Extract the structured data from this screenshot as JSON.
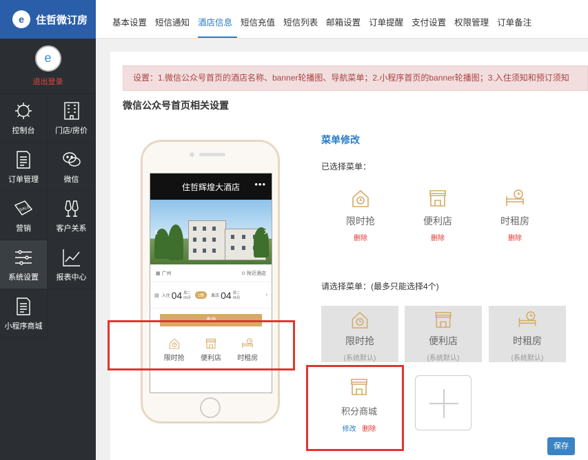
{
  "brand": {
    "name": "住哲微订房"
  },
  "user": {
    "logout": "退出登录"
  },
  "sidebar": {
    "items": [
      {
        "label": "控制台",
        "icon": "dashboard-icon"
      },
      {
        "label": "门店/房价",
        "icon": "building-icon"
      },
      {
        "label": "订单管理",
        "icon": "document-icon"
      },
      {
        "label": "微信",
        "icon": "wechat-icon"
      },
      {
        "label": "营销",
        "icon": "sale-tag-icon"
      },
      {
        "label": "客户关系",
        "icon": "glasses-icon"
      },
      {
        "label": "系统设置",
        "icon": "sliders-icon",
        "active": true
      },
      {
        "label": "报表中心",
        "icon": "line-chart-icon"
      },
      {
        "label": "小程序商城",
        "icon": "document-icon"
      }
    ]
  },
  "tabs": [
    "基本设置",
    "短信通知",
    "酒店信息",
    "短信充值",
    "短信列表",
    "邮箱设置",
    "订单提醒",
    "支付设置",
    "权限管理",
    "订单备注"
  ],
  "active_tab": "酒店信息",
  "alert": "设置：1.微信公众号首页的酒店名称、banner轮播图、导航菜单；2.小程序首页的banner轮播图；3.入住须知和预订须知",
  "section_title": "微信公众号首页相关设置",
  "preview": {
    "hotel_name": "住哲辉煌大酒店",
    "more": "•••",
    "city": "广州",
    "nearby": "附近酒店",
    "checkin": {
      "label": "入住",
      "day": "04",
      "week": "周二",
      "month": "06月"
    },
    "nights": "1晚",
    "checkout": {
      "label": "离店",
      "day": "04",
      "week": "周二",
      "month": "06月"
    },
    "search_button": "查询",
    "menu": [
      "限时抢",
      "便利店",
      "时租房"
    ]
  },
  "menu_edit": {
    "title": "菜单修改",
    "selected_label": "已选择菜单：",
    "selected": [
      {
        "name": "限时抢",
        "action": "删除"
      },
      {
        "name": "便利店",
        "action": "删除"
      },
      {
        "name": "时租房",
        "action": "删除"
      }
    ],
    "choose_label": "请选择菜单：(最多只能选择4个)",
    "options": [
      {
        "name": "限时抢",
        "note": "(系统默认)"
      },
      {
        "name": "便利店",
        "note": "(系统默认)"
      },
      {
        "name": "时租房",
        "note": "(系统默认)"
      }
    ],
    "custom": {
      "name": "积分商城",
      "edit": "修改",
      "delete": "删除"
    },
    "save": "保存"
  },
  "colors": {
    "brand": "#2a5ea8",
    "accent": "#2a7cc7",
    "gold": "#d6aa63",
    "danger": "#e3342f"
  }
}
